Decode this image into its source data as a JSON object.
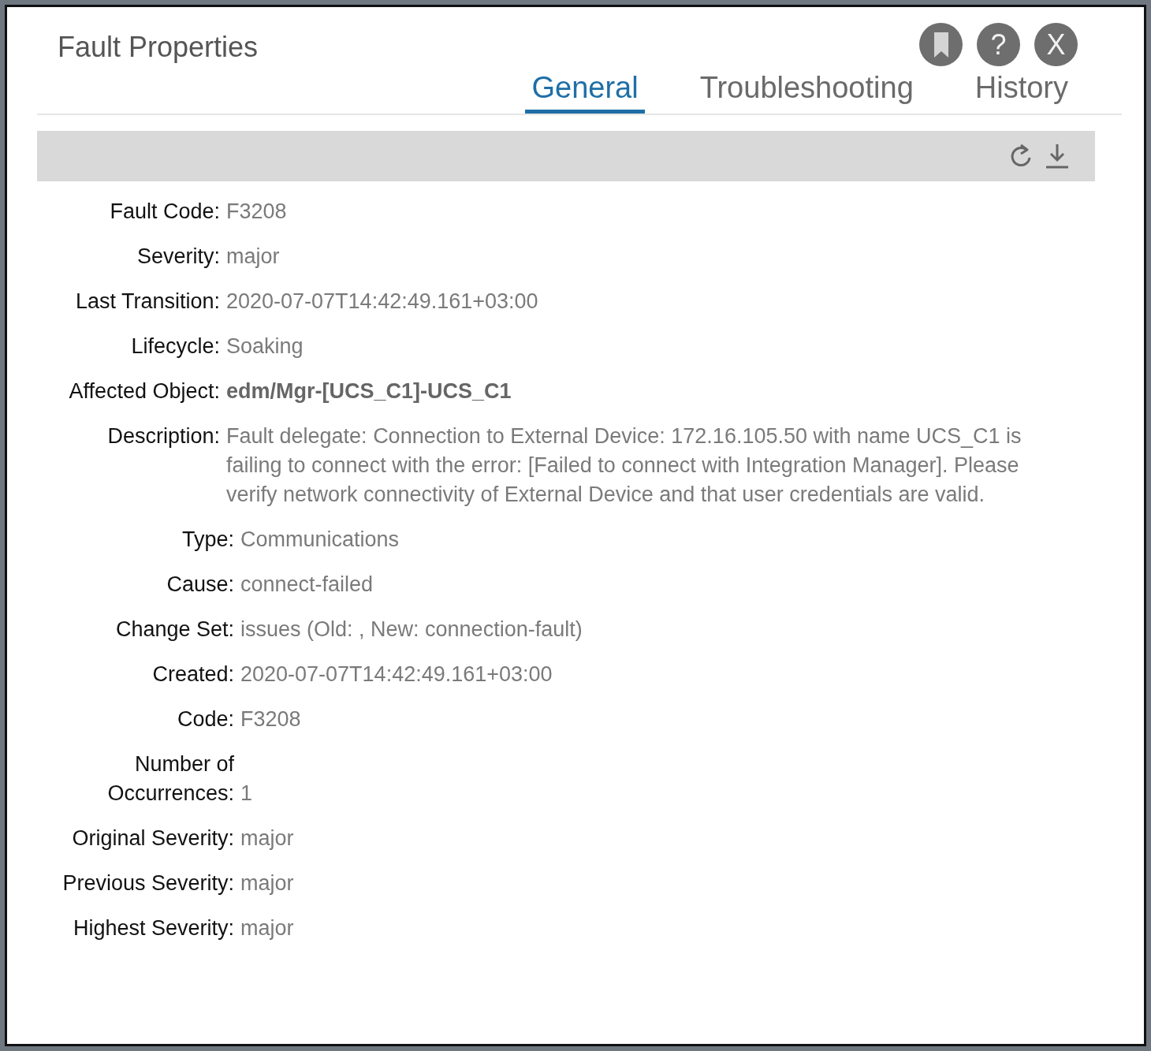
{
  "window": {
    "title": "Fault Properties",
    "actions": [
      {
        "kind": "bookmark"
      },
      {
        "kind": "help",
        "label": "?"
      },
      {
        "kind": "close",
        "label": "X"
      }
    ]
  },
  "tabs": [
    {
      "label": "General",
      "selected": true
    },
    {
      "label": "Troubleshooting",
      "selected": false
    },
    {
      "label": "History",
      "selected": false
    }
  ],
  "toolbar": {
    "actions": [
      {
        "kind": "refresh"
      },
      {
        "kind": "download"
      }
    ]
  },
  "sections": [
    {
      "fields": [
        {
          "label": "Fault Code:",
          "value": "F3208",
          "bold": false
        },
        {
          "label": "Severity:",
          "value": "major",
          "bold": false
        },
        {
          "label": "Last Transition:",
          "value": "2020-07-07T14:42:49.161+03:00",
          "bold": false
        },
        {
          "label": "Lifecycle:",
          "value": "Soaking",
          "bold": false
        },
        {
          "label": "Affected Object:",
          "value": "edm/Mgr-[UCS_C1]-UCS_C1",
          "bold": true
        },
        {
          "label": "Description:",
          "value": "Fault delegate: Connection to External Device: 172.16.105.50 with name UCS_C1 is failing to connect with the error: [Failed to connect with Integration Manager]. Please verify network connectivity of External Device and that user credentials are valid.",
          "bold": false
        }
      ]
    },
    {
      "fields": [
        {
          "label": "Type:",
          "value": "Communications",
          "bold": false
        },
        {
          "label": "Cause:",
          "value": "connect-failed",
          "bold": false
        },
        {
          "label": "Change Set:",
          "value": "issues (Old: , New: connection-fault)",
          "bold": false
        },
        {
          "label": "Created:",
          "value": "2020-07-07T14:42:49.161+03:00",
          "bold": false
        },
        {
          "label": "Code:",
          "value": "F3208",
          "bold": false
        },
        {
          "label": "Number of Occurrences:",
          "value": "1",
          "bold": false
        },
        {
          "label": "Original Severity:",
          "value": "major",
          "bold": false
        },
        {
          "label": "Previous Severity:",
          "value": "major",
          "bold": false
        },
        {
          "label": "Highest Severity:",
          "value": "major",
          "bold": false
        }
      ]
    }
  ]
}
